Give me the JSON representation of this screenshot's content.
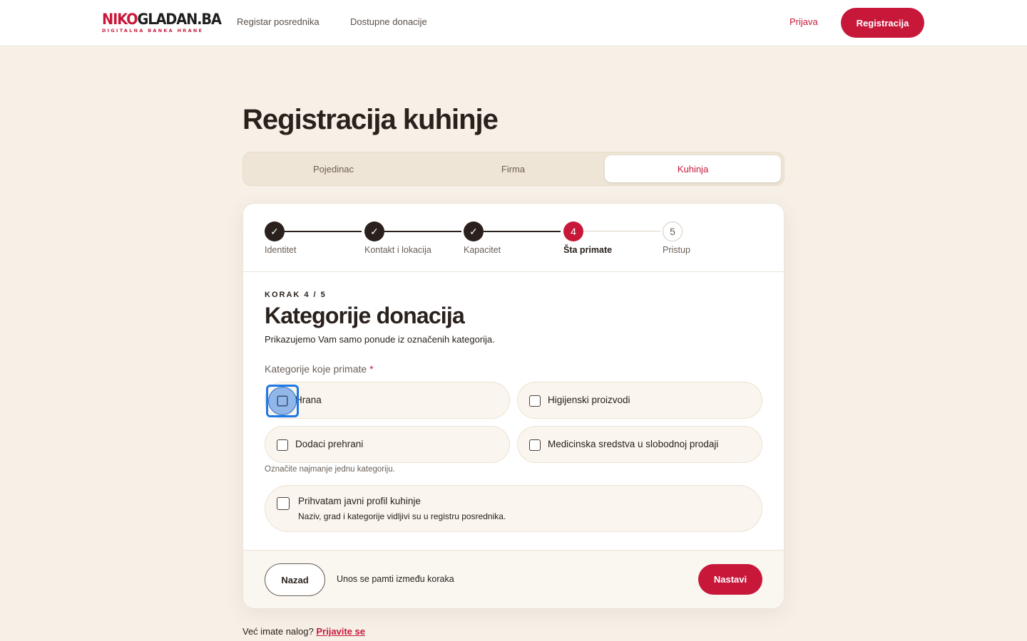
{
  "header": {
    "logo_main_red": "NIKO",
    "logo_main_dark": "GLADAN.BA",
    "logo_sub": "DIGITALNA BANKA HRANE",
    "nav": [
      "Registar posrednika",
      "Dostupne donacije"
    ],
    "login": "Prijava",
    "register": "Registracija"
  },
  "page_title": "Registracija kuhinje",
  "tabs": [
    {
      "label": "Pojedinac",
      "active": false
    },
    {
      "label": "Firma",
      "active": false
    },
    {
      "label": "Kuhinja",
      "active": true
    }
  ],
  "stepper": {
    "steps": [
      {
        "number": "1",
        "label": "Identitet",
        "state": "done"
      },
      {
        "number": "2",
        "label": "Kontakt i lokacija",
        "state": "done"
      },
      {
        "number": "3",
        "label": "Kapacitet",
        "state": "done"
      },
      {
        "number": "4",
        "label": "Šta primate",
        "state": "current"
      },
      {
        "number": "5",
        "label": "Pristup",
        "state": "todo"
      }
    ],
    "check_glyph": "✓"
  },
  "form": {
    "eyebrow": "KORAK 4 / 5",
    "title": "Kategorije donacija",
    "description": "Prikazujemo Vam samo ponude iz označenih kategorija.",
    "field_label": "Kategorije koje primate",
    "required_mark": "*",
    "options": [
      "Hrana",
      "Higijenski proizvodi",
      "Dodaci prehrani",
      "Medicinska sredstva u slobodnoj prodaji"
    ],
    "hint": "Označite najmanje jednu kategoriju.",
    "public_profile": {
      "title": "Prihvatam javni profil kuhinje",
      "description": "Naziv, grad i kategorije vidljivi su u registru posrednika."
    }
  },
  "footer": {
    "back": "Nazad",
    "saved_note": "Unos se pamti između koraka",
    "next": "Nastavi"
  },
  "bottom": {
    "question": "Već imate nalog?",
    "link": "Prijavite se"
  },
  "colors": {
    "accent": "#c8183a",
    "background": "#f6f0e7",
    "dark": "#2a211c"
  }
}
